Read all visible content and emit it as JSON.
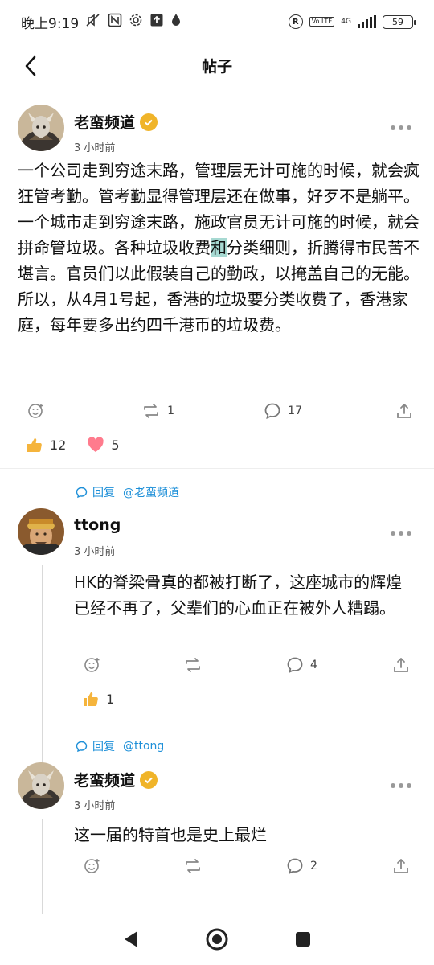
{
  "status_bar": {
    "time": "晚上9:19",
    "network": "4G",
    "battery": "59",
    "hd": "R",
    "volte": "Vo LTE"
  },
  "header": {
    "title": "帖子"
  },
  "main_post": {
    "author": "老蛮频道",
    "time": "3 小时前",
    "text_before_highlight": "一个公司走到穷途末路，管理层无计可施的时候，就会疯狂管考勤。管考勤显得管理层还在做事，好歹不是躺平。\n一个城市走到穷途末路，施政官员无计可施的时候，就会拼命管垃圾。各种垃圾收费",
    "highlight": "和",
    "text_after_highlight": "分类细则，折腾得市民苦不堪言。官员们以此假装自己的勤政，以掩盖自己的无能。\n所以，从4月1号起，香港的垃圾要分类收费了，香港家庭，每年要多出约四千港币的垃圾费。",
    "reposts": "1",
    "comments": "17",
    "likes": "12",
    "hearts": "5"
  },
  "reply1": {
    "reply_label": "回复",
    "reply_to": "@老蛮频道",
    "author": "ttong",
    "time": "3 小时前",
    "text": "HK的脊梁骨真的都被打断了，这座城市的辉煌已经不再了，父辈们的心血正在被外人糟蹋。",
    "comments": "4",
    "likes": "1"
  },
  "reply2": {
    "reply_label": "回复",
    "reply_to": "@ttong",
    "author": "老蛮频道",
    "time": "3 小时前",
    "text": "这一届的特首也是史上最烂",
    "comments": "2"
  },
  "colors": {
    "accent": "#1d8fd8",
    "verified": "#f0b429",
    "highlight": "#a7d9d2",
    "heart": "#ff6b81",
    "thumbs": "#f5b43c"
  },
  "icons": {
    "back": "chevron-left-icon",
    "more": "more-dots-icon",
    "emoji": "emoji-add-icon",
    "repost": "repost-icon",
    "comment": "comment-icon",
    "share": "share-icon",
    "reply": "reply-bubble-icon",
    "thumbs": "thumbs-up-icon",
    "heart": "heart-icon",
    "nav_back": "triangle-back-icon",
    "nav_home": "circle-home-icon",
    "nav_recent": "square-recent-icon"
  }
}
